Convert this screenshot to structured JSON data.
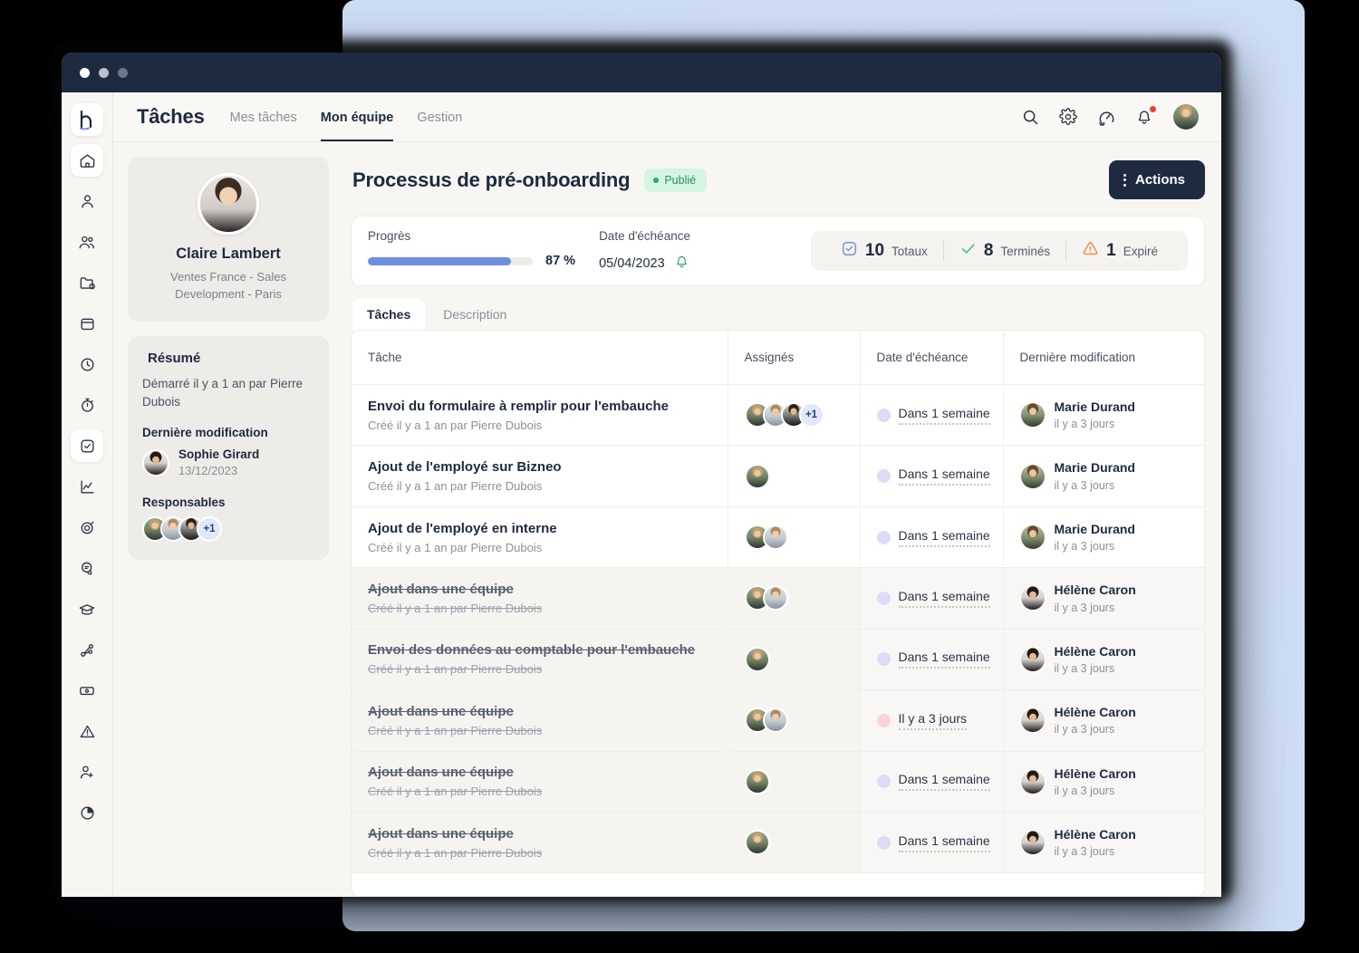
{
  "window": {
    "traffic_lights": [
      "close",
      "minimize",
      "maximize"
    ]
  },
  "topnav": {
    "app_title": "Tâches",
    "tabs": [
      {
        "label": "Mes tâches",
        "active": false
      },
      {
        "label": "Mon équipe",
        "active": true
      },
      {
        "label": "Gestion",
        "active": false
      }
    ],
    "icons": [
      {
        "name": "search-icon"
      },
      {
        "name": "gear-icon"
      },
      {
        "name": "speedometer-icon"
      },
      {
        "name": "bell-icon",
        "has_badge": true
      },
      {
        "name": "avatar"
      }
    ]
  },
  "rail": {
    "items": [
      {
        "name": "brand-logo-icon",
        "active": true
      },
      {
        "name": "home-icon",
        "active": true
      },
      {
        "name": "user-icon",
        "active": false
      },
      {
        "name": "users-icon",
        "active": false
      },
      {
        "name": "folder-icon",
        "active": false
      },
      {
        "name": "calendar-icon",
        "active": false
      },
      {
        "name": "clock-icon",
        "active": false
      },
      {
        "name": "timer-icon",
        "active": false
      },
      {
        "name": "checkbox-task-icon",
        "active": true
      },
      {
        "name": "chart-line-icon",
        "active": false
      },
      {
        "name": "target-icon",
        "active": false
      },
      {
        "name": "chat-icon",
        "active": false
      },
      {
        "name": "graduation-cap-icon",
        "active": false
      },
      {
        "name": "org-chart-icon",
        "active": false
      },
      {
        "name": "money-icon",
        "active": false
      },
      {
        "name": "alert-triangle-icon",
        "active": false
      },
      {
        "name": "user-add-icon",
        "active": false
      },
      {
        "name": "pie-chart-icon",
        "active": false
      }
    ]
  },
  "profile": {
    "name": "Claire Lambert",
    "subtitle_line1": "Ventes France - Sales",
    "subtitle_line2": "Development - Paris"
  },
  "summary": {
    "title": "Résumé",
    "started_text": "Démarré il y a 1 an par Pierre Dubois",
    "last_modified_label": "Dernière modification",
    "last_modified_name": "Sophie Girard",
    "last_modified_date": "13/12/2023",
    "responsables_label": "Responsables",
    "responsables_more": "+1"
  },
  "page": {
    "title": "Processus de pré-onboarding",
    "status_badge": "Publié",
    "actions_label": "Actions"
  },
  "stats": {
    "progress_label": "Progrès",
    "progress_percent_text": "87 %",
    "progress_percent_value": 87,
    "due_label": "Date d'échéance",
    "due_value": "05/04/2023",
    "chips": [
      {
        "icon": "checkbox-icon",
        "number": "10",
        "label": "Totaux",
        "color": "#7b8fd8"
      },
      {
        "icon": "check-icon",
        "number": "8",
        "label": "Terminés",
        "color": "#3dc08a"
      },
      {
        "icon": "warning-icon",
        "number": "1",
        "label": "Expiré",
        "color": "#f0893c"
      }
    ]
  },
  "subtabs": [
    {
      "label": "Tâches",
      "active": true
    },
    {
      "label": "Description",
      "active": false
    }
  ],
  "table": {
    "columns": [
      "Tâche",
      "Assignés",
      "Date d'échéance",
      "Dernière modification"
    ],
    "rows": [
      {
        "task": "Envoi du formulaire à remplir pour l'embauche",
        "created": "Créé il y a 1 an par Pierre Dubois",
        "done": false,
        "assignees": [
          "f1",
          "m1",
          "m2"
        ],
        "assignees_more": "+1",
        "due": "Dans 1 semaine",
        "due_state": "blue",
        "modifier": "Marie Durand",
        "modified": "il y a 3 jours",
        "modifier_photo": "f4"
      },
      {
        "task": "Ajout de l'employé sur Bizneo",
        "created": "Créé il y a 1 an par Pierre Dubois",
        "done": false,
        "assignees": [
          "f1"
        ],
        "assignees_more": "",
        "due": "Dans 1 semaine",
        "due_state": "blue",
        "modifier": "Marie Durand",
        "modified": "il y a 3 jours",
        "modifier_photo": "f4"
      },
      {
        "task": "Ajout de l'employé en interne",
        "created": "Créé il y a 1 an par Pierre Dubois",
        "done": false,
        "assignees": [
          "f1",
          "m1"
        ],
        "assignees_more": "",
        "due": "Dans 1 semaine",
        "due_state": "blue",
        "modifier": "Marie Durand",
        "modified": "il y a 3 jours",
        "modifier_photo": "f4"
      },
      {
        "task": "Ajout dans une équipe",
        "created": "Créé il y a 1 an par Pierre Dubois",
        "done": true,
        "assignees": [
          "f1",
          "m1"
        ],
        "assignees_more": "",
        "due": "Dans 1 semaine",
        "due_state": "blue",
        "modifier": "Hélène Caron",
        "modified": "il y a 3 jours",
        "modifier_photo": "f3"
      },
      {
        "task": "Envoi des données au comptable pour l'embauche",
        "created": "Créé il y a 1 an par Pierre Dubois",
        "done": true,
        "assignees": [
          "f1"
        ],
        "assignees_more": "",
        "due": "Dans 1 semaine",
        "due_state": "blue",
        "modifier": "Hélène Caron",
        "modified": "il y a 3 jours",
        "modifier_photo": "f3"
      },
      {
        "task": "Ajout dans une équipe",
        "created": "Créé il y a 1 an par Pierre Dubois",
        "done": true,
        "assignees": [
          "f1",
          "m1"
        ],
        "assignees_more": "",
        "due": "Il y a 3 jours",
        "due_state": "red",
        "modifier": "Hélène Caron",
        "modified": "il y a 3 jours",
        "modifier_photo": "f3"
      },
      {
        "task": "Ajout dans une équipe",
        "created": "Créé il y a 1 an par Pierre Dubois",
        "done": true,
        "assignees": [
          "f1"
        ],
        "assignees_more": "",
        "due": "Dans 1 semaine",
        "due_state": "blue",
        "modifier": "Hélène Caron",
        "modified": "il y a 3 jours",
        "modifier_photo": "f3"
      },
      {
        "task": "Ajout dans une équipe",
        "created": "Créé il y a 1 an par Pierre Dubois",
        "done": true,
        "assignees": [
          "f1"
        ],
        "assignees_more": "",
        "due": "Dans 1 semaine",
        "due_state": "blue",
        "modifier": "Hélène Caron",
        "modified": "il y a 3 jours",
        "modifier_photo": "f3"
      }
    ]
  },
  "colors": {
    "brand_dark": "#1e2a40",
    "progress_blue": "#6e8fe0",
    "badge_green_bg": "#d4f5e2",
    "badge_green_text": "#2f8f63",
    "backdrop_blue": "#cddcf5",
    "notification_red": "#ef3e36"
  }
}
